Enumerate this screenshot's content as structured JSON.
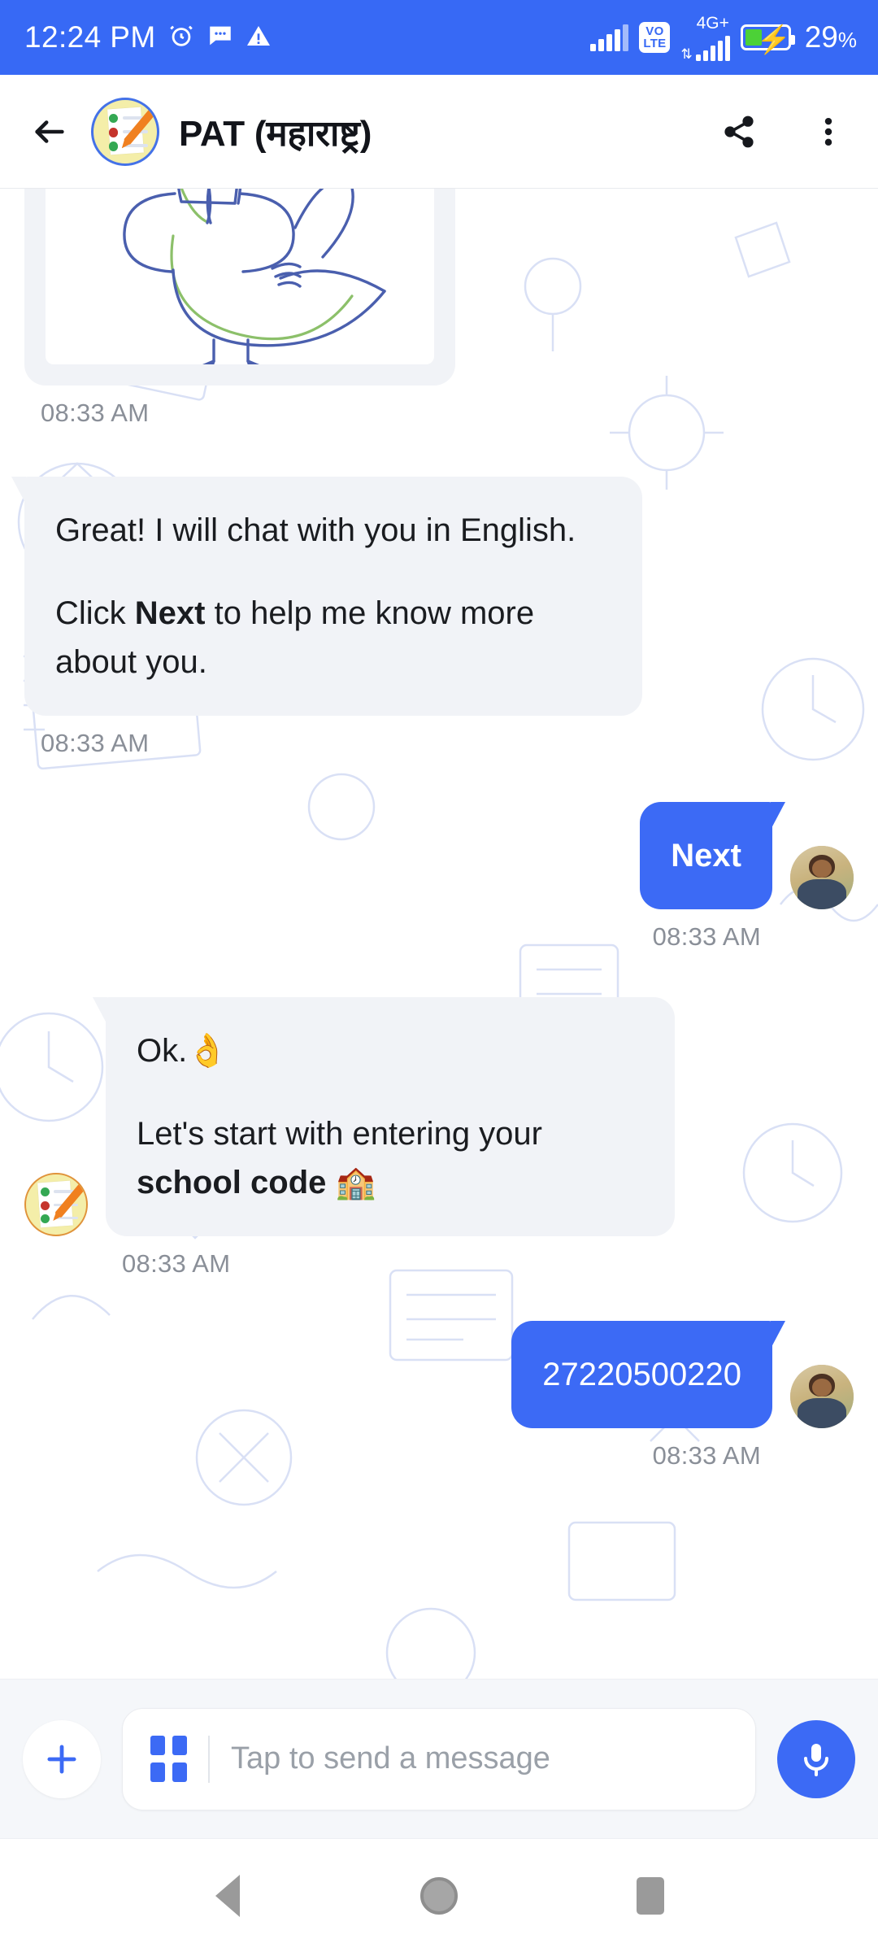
{
  "status_bar": {
    "time": "12:24 PM",
    "icons_left": [
      "alarm-icon",
      "message-icon",
      "warning-icon"
    ],
    "network_label": "4G+",
    "volte_top": "VO",
    "volte_bottom": "LTE",
    "battery_percent": "29",
    "percent_sign": "%",
    "background_color": "#3769F5"
  },
  "app_bar": {
    "back_icon": "back-arrow-icon",
    "avatar": "pat-bot-avatar",
    "title": "PAT (महाराष्ट्र)",
    "share_icon": "share-icon",
    "overflow_icon": "more-vertical-icon"
  },
  "chat": {
    "messages": [
      {
        "id": "msg-bird-image",
        "sender": "bot",
        "type": "image",
        "image_name": "namaste-bird-drawing",
        "timestamp": "08:33 AM"
      },
      {
        "id": "msg-greeting",
        "sender": "bot",
        "type": "text",
        "line1": "Great! I will chat with you in English.",
        "line2_pre": "Click ",
        "line2_bold": "Next",
        "line2_post": " to help me know more about you.",
        "timestamp": "08:33 AM"
      },
      {
        "id": "msg-next",
        "sender": "user",
        "type": "text",
        "text": "Next",
        "timestamp": "08:33 AM"
      },
      {
        "id": "msg-school-code-prompt",
        "sender": "bot",
        "type": "text",
        "line1": "Ok.👌",
        "line2_pre": "Let's start with entering your ",
        "line2_bold": "school code",
        "line2_post": " 🏫",
        "timestamp": "08:33 AM"
      },
      {
        "id": "msg-school-code",
        "sender": "user",
        "type": "text",
        "text": "27220500220",
        "timestamp": "08:33 AM"
      }
    ]
  },
  "input_bar": {
    "plus_icon": "plus-icon",
    "grid_icon": "grid-menu-icon",
    "placeholder": "Tap to send a message",
    "mic_icon": "microphone-icon",
    "accent_color": "#3C6AF5"
  },
  "nav_bar": {
    "back": "nav-back-icon",
    "home": "nav-home-icon",
    "recents": "nav-recents-icon"
  }
}
